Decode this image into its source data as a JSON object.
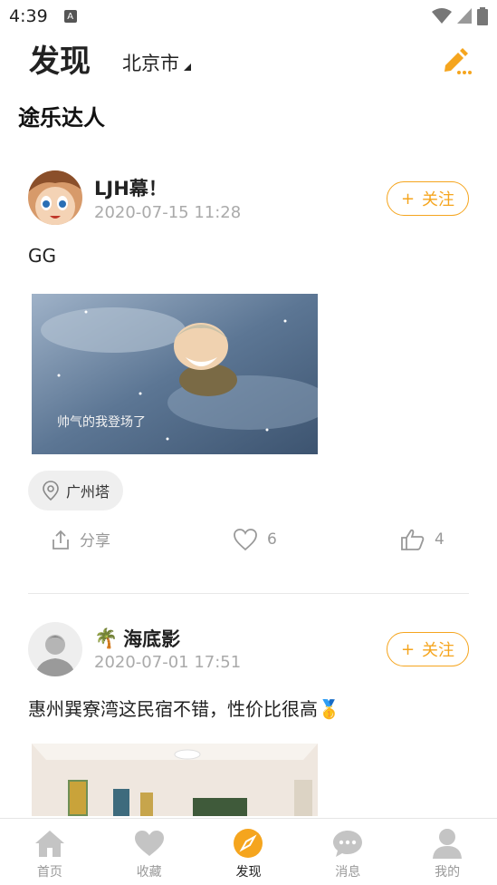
{
  "status_bar": {
    "time": "4:39",
    "notification_icon": "A"
  },
  "header": {
    "title": "发现",
    "city": "北京市",
    "edit_icon": "edit-pencil-icon"
  },
  "section_title": "途乐达人",
  "colors": {
    "accent": "#f5a51e",
    "muted": "#999999",
    "date": "#aaaaaa"
  },
  "posts": [
    {
      "user": "LJH幕！",
      "date": "2020-07-15 11:28",
      "follow_label": "关注",
      "text": "GG",
      "image_caption": "帅气的我登场了",
      "location": "广州塔",
      "share_label": "分享",
      "likes": "6",
      "thumbs": "4"
    },
    {
      "user_emoji": "🌴",
      "user": "海底影",
      "date": "2020-07-01 17:51",
      "follow_label": "关注",
      "text": "惠州巽寮湾这民宿不错，性价比很高🥇"
    }
  ],
  "tabs": [
    {
      "label": "首页",
      "icon": "home-icon",
      "active": false
    },
    {
      "label": "收藏",
      "icon": "heart-icon",
      "active": false
    },
    {
      "label": "发现",
      "icon": "compass-icon",
      "active": true
    },
    {
      "label": "消息",
      "icon": "chat-bubble-icon",
      "active": false
    },
    {
      "label": "我的",
      "icon": "user-icon",
      "active": false
    }
  ]
}
